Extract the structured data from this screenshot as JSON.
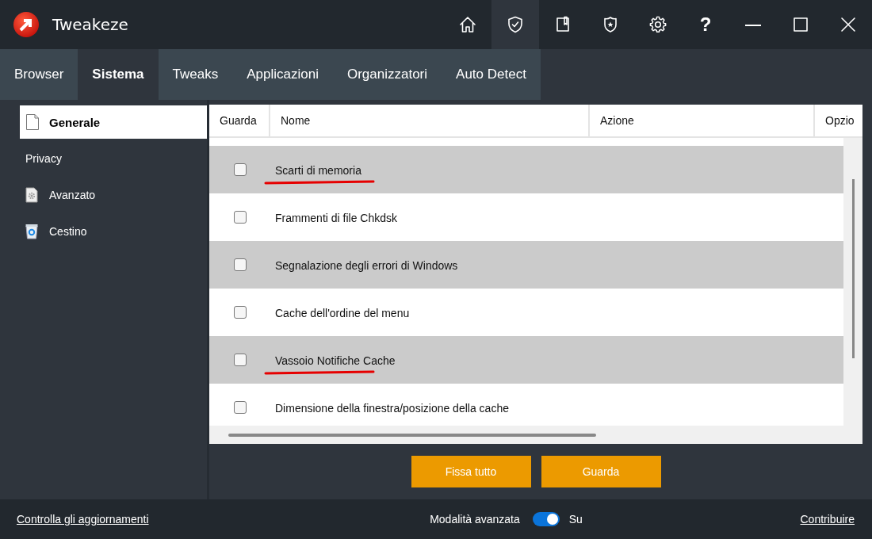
{
  "window": {
    "title": "Tweakeze"
  },
  "toolbar": [
    {
      "kind": "home",
      "selected": false
    },
    {
      "kind": "shield",
      "selected": true
    },
    {
      "kind": "book",
      "selected": false
    },
    {
      "kind": "badge",
      "selected": false
    },
    {
      "kind": "settings",
      "selected": false
    },
    {
      "kind": "help",
      "label": "?",
      "selected": false
    }
  ],
  "tabs": [
    {
      "label": "Browser",
      "selected": false
    },
    {
      "label": "Sistema",
      "selected": true
    },
    {
      "label": "Tweaks",
      "selected": false
    },
    {
      "label": "Applicazioni",
      "selected": false
    },
    {
      "label": "Organizzatori",
      "selected": false
    },
    {
      "label": "Auto Detect",
      "selected": false
    }
  ],
  "sidebar": {
    "items": [
      {
        "label": "Generale",
        "kind": "page",
        "selected": true
      },
      {
        "label": "Privacy",
        "kind": "plain",
        "selected": false
      },
      {
        "label": "Avanzato",
        "kind": "gear-page",
        "selected": false
      },
      {
        "label": "Cestino",
        "kind": "bin",
        "selected": false
      }
    ]
  },
  "table": {
    "columns": [
      "Guarda",
      "Nome",
      "Azione",
      "Opzio"
    ],
    "rows": [
      {
        "name": "Scarti di memoria",
        "checked": false,
        "marked": true
      },
      {
        "name": "Frammenti di file Chkdsk",
        "checked": false,
        "marked": false
      },
      {
        "name": "Segnalazione degli errori di Windows",
        "checked": false,
        "marked": false
      },
      {
        "name": "Cache dell'ordine del menu",
        "checked": false,
        "marked": false
      },
      {
        "name": "Vassoio Notifiche Cache",
        "checked": false,
        "marked": true
      },
      {
        "name": "Dimensione della finestra/posizione della cache",
        "checked": false,
        "marked": false
      }
    ]
  },
  "buttons": [
    "Fissa tutto",
    "Guarda"
  ],
  "status_bar": {
    "update_link": "Controlla gli aggiornamenti",
    "mode_label": "Modalità avanzata",
    "mode_toggle": {
      "on": true,
      "label": "Su"
    },
    "contribute_link": "Contribuire"
  }
}
